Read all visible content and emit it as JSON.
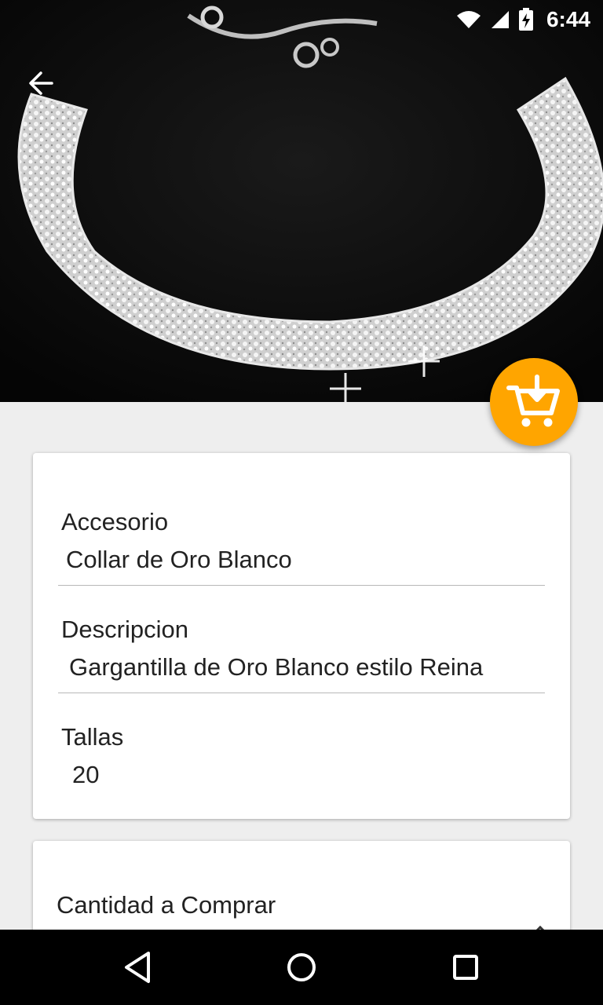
{
  "status_bar": {
    "time": "6:44"
  },
  "product_image": {
    "alt_icon": "crystal-choker-necklace-image"
  },
  "fields": {
    "accesorio": {
      "label": "Accesorio",
      "value": "Collar de Oro Blanco"
    },
    "descripcion": {
      "label": "Descripcion",
      "value": "Gargantilla de Oro Blanco estilo Reina"
    },
    "tallas": {
      "label": "Tallas",
      "value": "20"
    }
  },
  "quantity": {
    "label": "Cantidad a Comprar"
  },
  "colors": {
    "fab": "#ffa500",
    "background": "#eeeeee",
    "card": "#ffffff"
  }
}
